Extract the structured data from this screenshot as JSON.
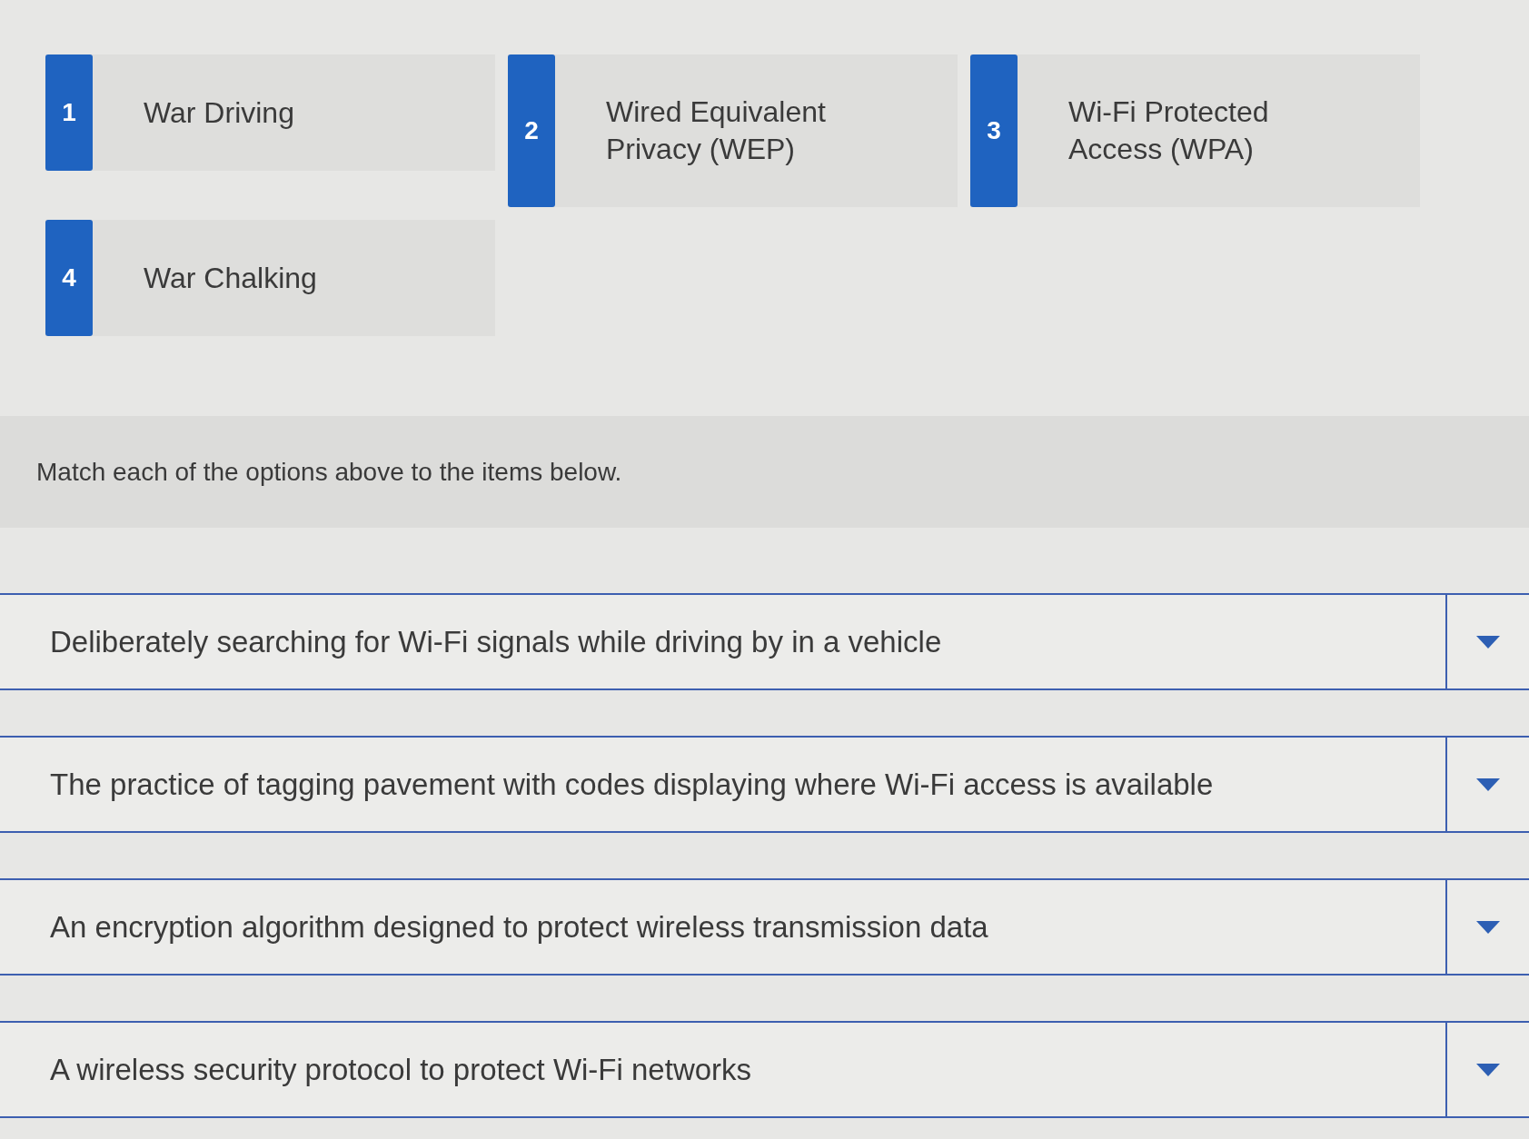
{
  "options": [
    {
      "number": "1",
      "label": "War Driving"
    },
    {
      "number": "2",
      "label": "Wired Equivalent Privacy (WEP)"
    },
    {
      "number": "3",
      "label": "Wi-Fi Protected Access (WPA)"
    },
    {
      "number": "4",
      "label": "War Chalking"
    }
  ],
  "instruction": "Match each of the options above to the items below.",
  "items": [
    {
      "text": "Deliberately searching for Wi-Fi signals while driving by in a vehicle"
    },
    {
      "text": "The practice of tagging pavement with codes displaying where Wi-Fi access is available"
    },
    {
      "text": "An encryption algorithm designed to protect wireless transmission data"
    },
    {
      "text": "A wireless security protocol to protect Wi-Fi networks"
    }
  ]
}
